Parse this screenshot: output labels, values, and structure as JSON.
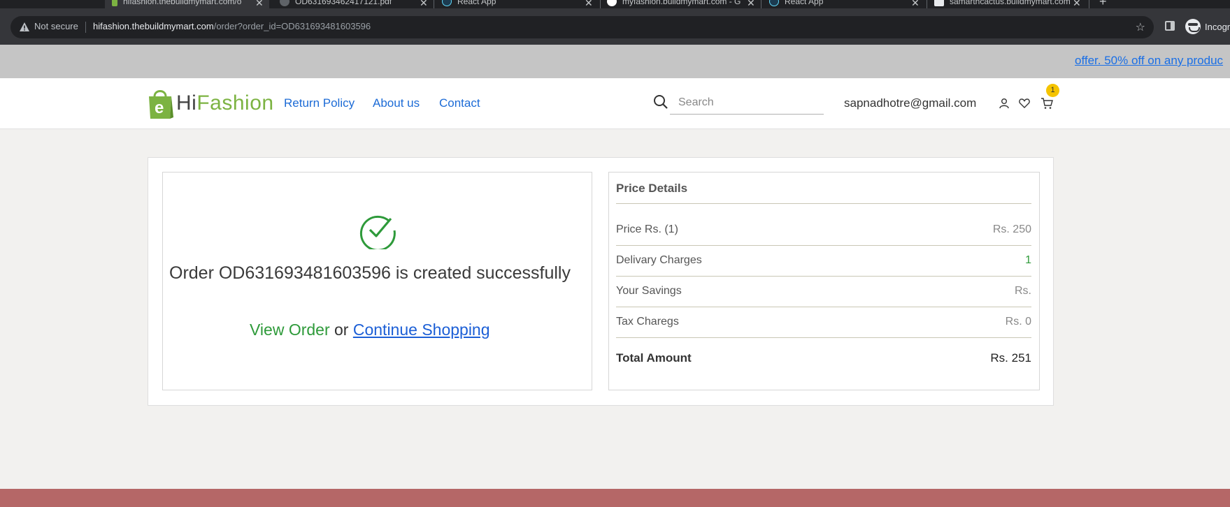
{
  "browser": {
    "tabs": [
      {
        "title": "hifashion.thebuildmymart.com/o",
        "active": true
      },
      {
        "title": "OD631693462417121.pdf",
        "active": false
      },
      {
        "title": "React App",
        "active": false
      },
      {
        "title": "myfashion.buildmymart.com - G",
        "active": false
      },
      {
        "title": "React App",
        "active": false
      },
      {
        "title": "samarthcactus.buildmymart.com",
        "active": false
      }
    ],
    "security_label": "Not secure",
    "url_host": "hifashion.thebuildmymart.com",
    "url_path": "/order?order_id=OD631693481603596",
    "profile_label": "Incogn"
  },
  "promo": {
    "text": "offer. 50% off on any produc"
  },
  "header": {
    "logo_hi": "Hi",
    "logo_fashion": "Fashion",
    "nav": [
      "Return Policy",
      "About us",
      "Contact"
    ],
    "search_placeholder": "Search",
    "user_email": "sapnadhotre@gmail.com",
    "cart_count": "1"
  },
  "order": {
    "message": "Order OD631693481603596 is created successfully",
    "view_order_label": "View Order",
    "or_label": "or",
    "continue_label": "Continue Shopping"
  },
  "price_details": {
    "title": "Price Details",
    "rows": [
      {
        "label": "Price Rs. (1)",
        "value": "Rs. 250"
      },
      {
        "label": "Delivary Charges",
        "value": "1"
      },
      {
        "label": "Your Savings",
        "value": "Rs."
      },
      {
        "label": "Tax Charegs",
        "value": "Rs. 0"
      }
    ],
    "total_label": "Total Amount",
    "total_value": "Rs. 251"
  },
  "colors": {
    "accent_green": "#2e9a3a",
    "link_blue": "#1c6bd6",
    "brand_green": "#7cb342",
    "badge_yellow": "#f5c400",
    "footer": "#b56767"
  }
}
